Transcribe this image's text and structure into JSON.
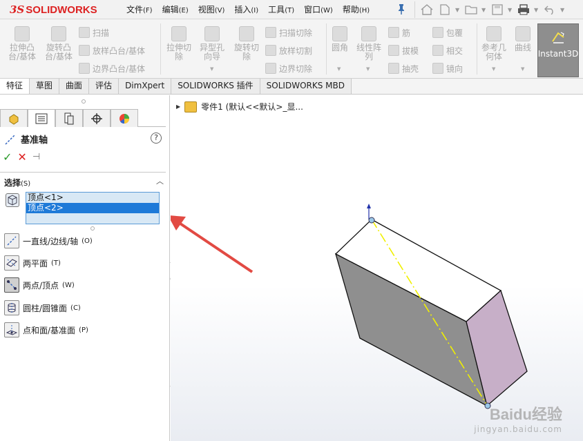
{
  "app": {
    "logo_ds": "3S",
    "logo_text": "SOLIDWORKS"
  },
  "menu": [
    {
      "label": "文件",
      "key": "(F)"
    },
    {
      "label": "编辑",
      "key": "(E)"
    },
    {
      "label": "视图",
      "key": "(V)"
    },
    {
      "label": "插入",
      "key": "(I)"
    },
    {
      "label": "工具",
      "key": "(T)"
    },
    {
      "label": "窗口",
      "key": "(W)"
    },
    {
      "label": "帮助",
      "key": "(H)"
    }
  ],
  "toolbar": {
    "extrude_boss": "拉伸凸\n台/基体",
    "revolve_boss": "旋转凸\n台/基体",
    "sweep": "扫描",
    "loft_boss": "放样凸台/基体",
    "boundary_boss": "边界凸台/基体",
    "extrude_cut": "拉伸切\n除",
    "hole_wizard": "异型孔\n向导",
    "revolve_cut": "旋转切\n除",
    "sweep_cut": "扫描切除",
    "loft_cut": "放样切割",
    "boundary_cut": "边界切除",
    "fillet": "圆角",
    "linear_pattern": "线性阵\n列",
    "rib": "筋",
    "draft": "拔模",
    "shell": "抽壳",
    "wrap": "包覆",
    "intersect": "相交",
    "mirror": "镜向",
    "ref_geometry": "参考几\n何体",
    "curves": "曲线",
    "instant3d": "Instant3D"
  },
  "tabs": [
    "特征",
    "草图",
    "曲面",
    "评估",
    "DimXpert",
    "SOLIDWORKS 插件",
    "SOLIDWORKS MBD"
  ],
  "propertymanager": {
    "title": "基准轴",
    "help": "?",
    "section_title": "选择",
    "section_key": "(S)",
    "selections": [
      "顶点<1>",
      "顶点<2>"
    ],
    "options": [
      {
        "label": "一直线/边线/轴",
        "key": "(O)"
      },
      {
        "label": "两平面",
        "key": "(T)"
      },
      {
        "label": "两点/顶点",
        "key": "(W)"
      },
      {
        "label": "圆柱/圆锥面",
        "key": "(C)"
      },
      {
        "label": "点和面/基准面",
        "key": "(P)"
      }
    ]
  },
  "tree": {
    "label": "零件1 (默认<<默认>_显..."
  },
  "watermark": {
    "main": "Baidu经验",
    "sub": "jingyan.baidu.com"
  },
  "colors": {
    "selection_highlight": "#1e7ad8",
    "axis_preview": "#f0f000",
    "annotation_arrow": "#e24a43",
    "logo": "#dd2222"
  }
}
